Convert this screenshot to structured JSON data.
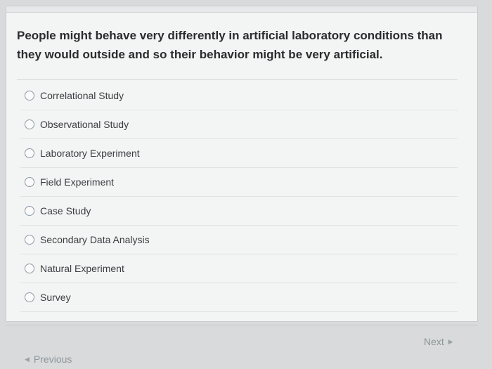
{
  "question": {
    "text": "People might behave very differently in artificial laboratory conditions than they would outside and so their behavior might be very artificial."
  },
  "options": [
    {
      "label": "Correlational Study"
    },
    {
      "label": "Observational Study"
    },
    {
      "label": "Laboratory Experiment"
    },
    {
      "label": "Field Experiment"
    },
    {
      "label": "Case Study"
    },
    {
      "label": "Secondary Data Analysis"
    },
    {
      "label": "Natural Experiment"
    },
    {
      "label": "Survey"
    }
  ],
  "nav": {
    "next_label": "Next",
    "previous_label": "Previous",
    "next_icon": "caret-right-icon",
    "previous_icon": "caret-left-icon"
  }
}
